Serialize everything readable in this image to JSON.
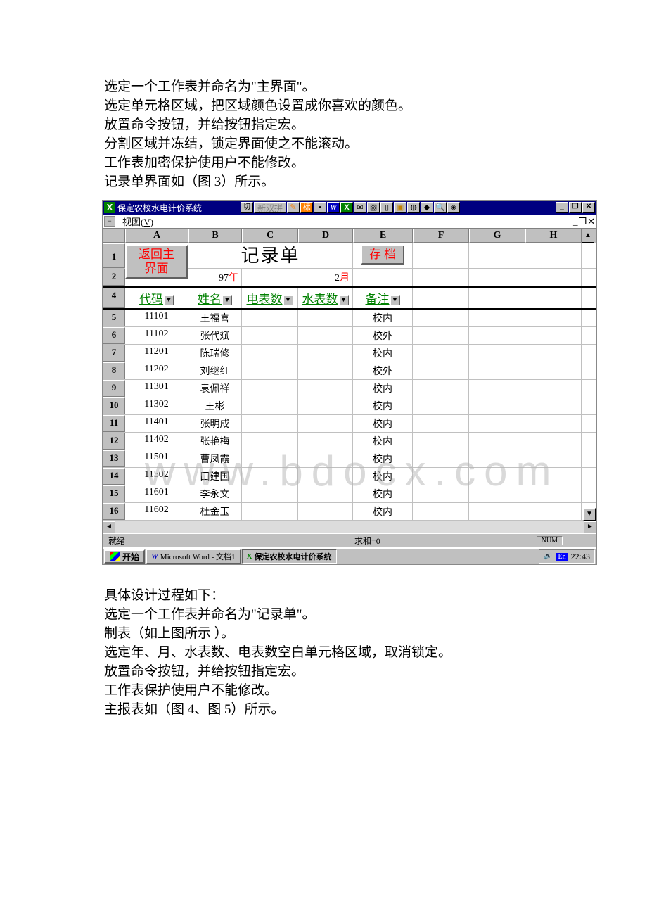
{
  "intro_lines": [
    "选定一个工作表并命名为\"主界面\"。",
    "选定单元格区域，把区域颜色设置成你喜欢的颜色。",
    "放置命令按钮，并给按钮指定宏。",
    "分割区域并冻结，锁定界面使之不能滚动。",
    "工作表加密保护使用户不能修改。",
    "记录单界面如（图 3）所示。"
  ],
  "outro_lines": [
    "具体设计过程如下：",
    "选定一个工作表并命名为\"记录单\"。",
    "制表（如上图所示 ）。",
    "选定年、月、水表数、电表数空白单元格区域，取消锁定。",
    "放置命令按钮，并给按钮指定宏。",
    "工作表保护使用户不能修改。",
    "主报表如（图 4、图 5）所示。"
  ],
  "title": "保定农校水电计价系统",
  "ime_text": "新双拼",
  "menu_view": "视图(V)",
  "columns": [
    "A",
    "B",
    "C",
    "D",
    "E",
    "F",
    "G",
    "H"
  ],
  "row1": {
    "back_btn": "返回主界面",
    "title": "记录单",
    "save_btn": "存 档"
  },
  "row2": {
    "year_num": "97",
    "year_lbl": "年",
    "month_num": "2",
    "month_lbl": "月"
  },
  "row4_headers": [
    "代码",
    "姓名",
    "电表数",
    "水表数",
    "备注"
  ],
  "data": [
    {
      "r": "5",
      "code": "11101",
      "name": "王福喜",
      "note": "校内"
    },
    {
      "r": "6",
      "code": "11102",
      "name": "张代斌",
      "note": "校外"
    },
    {
      "r": "7",
      "code": "11201",
      "name": "陈瑞修",
      "note": "校内"
    },
    {
      "r": "8",
      "code": "11202",
      "name": "刘继红",
      "note": "校外"
    },
    {
      "r": "9",
      "code": "11301",
      "name": "袁佩祥",
      "note": "校内"
    },
    {
      "r": "10",
      "code": "11302",
      "name": "王彬",
      "note": "校内"
    },
    {
      "r": "11",
      "code": "11401",
      "name": "张明成",
      "note": "校内"
    },
    {
      "r": "12",
      "code": "11402",
      "name": "张艳梅",
      "note": "校内"
    },
    {
      "r": "13",
      "code": "11501",
      "name": "曹凤霞",
      "note": "校内"
    },
    {
      "r": "14",
      "code": "11502",
      "name": "田建国",
      "note": "校内"
    },
    {
      "r": "15",
      "code": "11601",
      "name": "李永文",
      "note": "校内"
    },
    {
      "r": "16",
      "code": "11602",
      "name": "杜金玉",
      "note": "校内"
    }
  ],
  "status_ready": "就绪",
  "status_sum": "求和=0",
  "status_num": "NUM",
  "start": "开始",
  "task1": "Microsoft Word - 文档1",
  "task2": "保定农校水电计价系统",
  "tray_en": "En",
  "tray_time": "22:43",
  "watermark": "www.bdocx.com"
}
